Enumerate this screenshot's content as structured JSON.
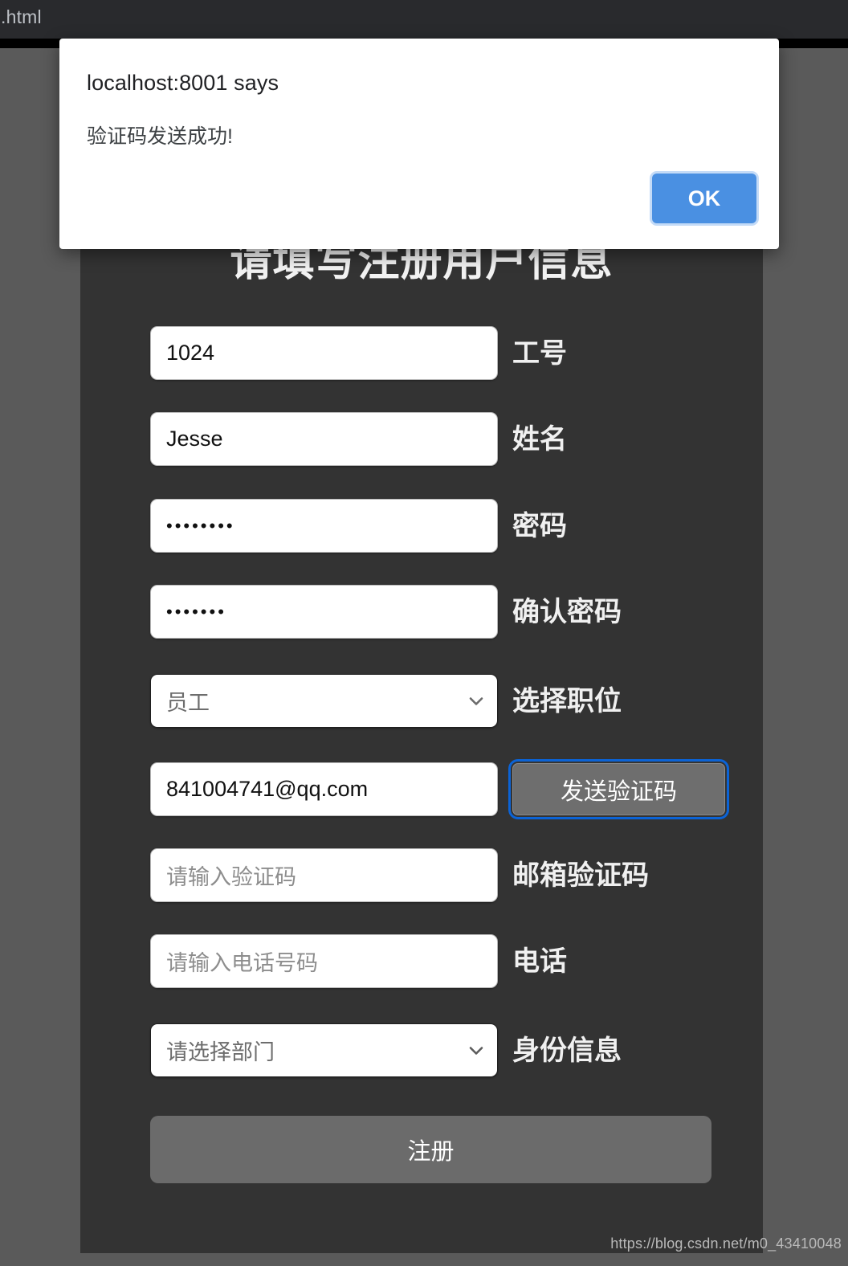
{
  "browser": {
    "tab_title": "p.html"
  },
  "dialog": {
    "origin": "localhost:8001 says",
    "message": "验证码发送成功!",
    "ok_label": "OK",
    "ok_color": "#4a90e2"
  },
  "form": {
    "title": "请填写注册用户信息",
    "submit_label": "注册",
    "rows": [
      {
        "name": "employee-id",
        "value": "1024",
        "placeholder": "",
        "label": "工号",
        "type": "text"
      },
      {
        "name": "full-name",
        "value": "Jesse",
        "placeholder": "",
        "label": "姓名",
        "type": "text"
      },
      {
        "name": "password",
        "value": "••••••••",
        "placeholder": "",
        "label": "密码",
        "type": "password"
      },
      {
        "name": "confirm-password",
        "value": "•••••••",
        "placeholder": "",
        "label": "确认密码",
        "type": "password"
      },
      {
        "name": "position",
        "value": "员工",
        "placeholder": "",
        "label": "选择职位",
        "type": "select"
      },
      {
        "name": "email",
        "value": "841004741@qq.com",
        "placeholder": "",
        "label": "发送验证码",
        "type": "text-with-button"
      },
      {
        "name": "email-code",
        "value": "",
        "placeholder": "请输入验证码",
        "label": "邮箱验证码",
        "type": "text"
      },
      {
        "name": "phone",
        "value": "",
        "placeholder": "请输入电话号码",
        "label": "电话",
        "type": "text"
      },
      {
        "name": "department",
        "value": "请选择部门",
        "placeholder": "请选择部门",
        "label": "身份信息",
        "type": "select"
      }
    ]
  },
  "watermark": {
    "text": "https://blog.csdn.net/m0_43410048"
  },
  "theme": {
    "panel_bg": "#333333",
    "page_bg": "#5a5a5a",
    "accent_focus": "#0b63d6",
    "button_gray": "#6b6b6b"
  }
}
